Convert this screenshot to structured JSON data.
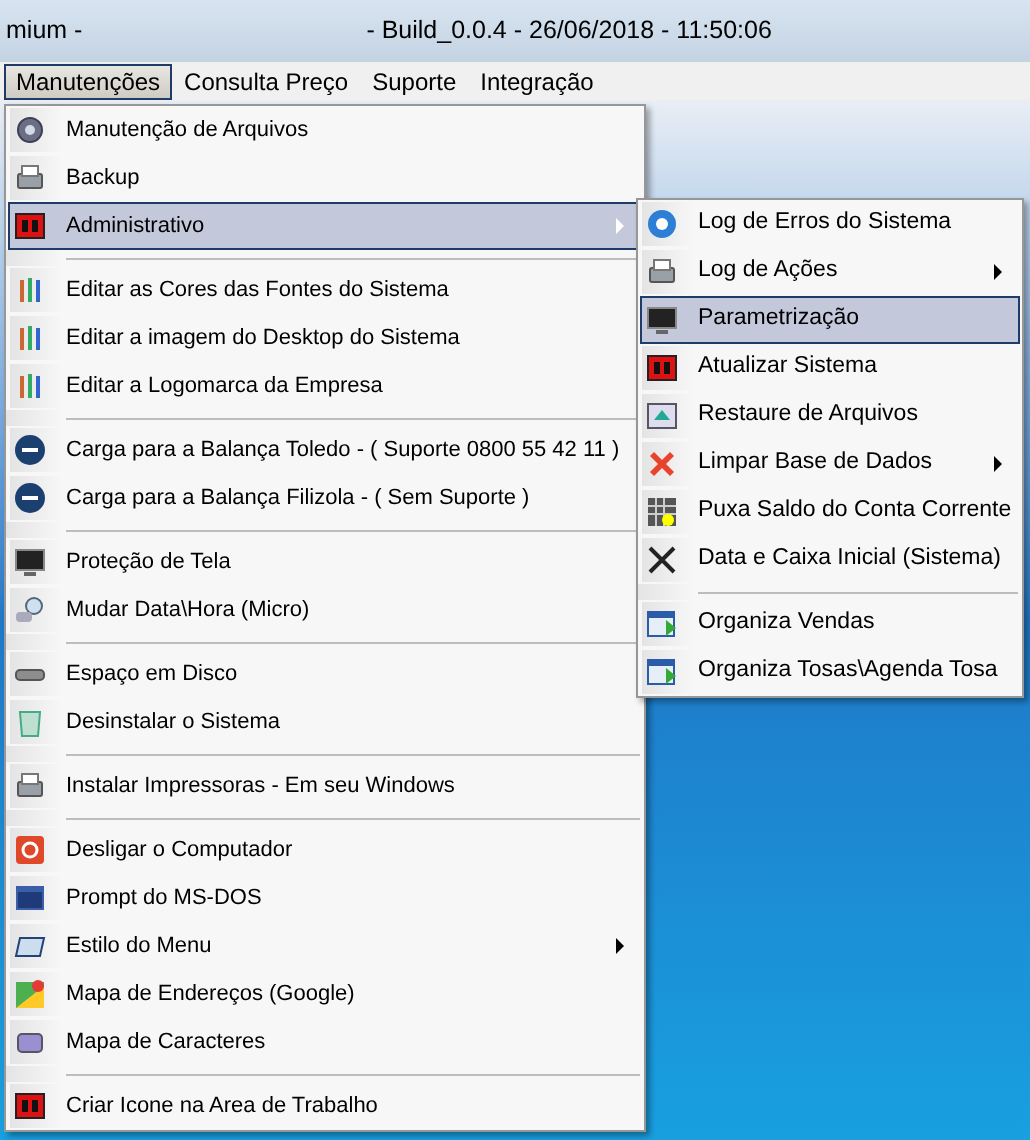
{
  "window": {
    "title_left": "mium -",
    "title": "- Build_0.0.4 - 26/06/2018 - 11:50:06"
  },
  "menu_bar": [
    {
      "label": "Manutenções",
      "selected": true
    },
    {
      "label": "Consulta Preço",
      "selected": false
    },
    {
      "label": "Suporte",
      "selected": false
    },
    {
      "label": "Integração",
      "selected": false
    }
  ],
  "menu": [
    {
      "kind": "item",
      "label": "Manutenção de Arquivos",
      "selected": false,
      "has_submenu": false
    },
    {
      "kind": "item",
      "label": "Backup",
      "selected": false,
      "has_submenu": false
    },
    {
      "kind": "item",
      "label": "Administrativo",
      "selected": true,
      "has_submenu": true
    },
    {
      "kind": "separator"
    },
    {
      "kind": "item",
      "label": "Editar as Cores das Fontes do Sistema",
      "selected": false,
      "has_submenu": false
    },
    {
      "kind": "item",
      "label": "Editar a imagem do Desktop do Sistema",
      "selected": false,
      "has_submenu": false
    },
    {
      "kind": "item",
      "label": "Editar a Logomarca da Empresa",
      "selected": false,
      "has_submenu": false
    },
    {
      "kind": "separator"
    },
    {
      "kind": "item",
      "label": "Carga para a Balança Toledo - ( Suporte 0800 55 42 11 )",
      "selected": false,
      "has_submenu": false
    },
    {
      "kind": "item",
      "label": "Carga para a Balança Filizola - ( Sem Suporte )",
      "selected": false,
      "has_submenu": false
    },
    {
      "kind": "separator"
    },
    {
      "kind": "item",
      "label": "Proteção de Tela",
      "selected": false,
      "has_submenu": false
    },
    {
      "kind": "item",
      "label": "Mudar Data\\Hora (Micro)",
      "selected": false,
      "has_submenu": false
    },
    {
      "kind": "separator"
    },
    {
      "kind": "item",
      "label": "Espaço em Disco",
      "selected": false,
      "has_submenu": false
    },
    {
      "kind": "item",
      "label": "Desinstalar o Sistema",
      "selected": false,
      "has_submenu": false
    },
    {
      "kind": "separator"
    },
    {
      "kind": "item",
      "label": "Instalar Impressoras - Em seu Windows",
      "selected": false,
      "has_submenu": false
    },
    {
      "kind": "separator"
    },
    {
      "kind": "item",
      "label": "Desligar o Computador",
      "selected": false,
      "has_submenu": false
    },
    {
      "kind": "item",
      "label": "Prompt do MS-DOS",
      "selected": false,
      "has_submenu": false
    },
    {
      "kind": "item",
      "label": "Estilo do Menu",
      "selected": false,
      "has_submenu": true
    },
    {
      "kind": "item",
      "label": "Mapa de Endereços (Google)",
      "selected": false,
      "has_submenu": false
    },
    {
      "kind": "item",
      "label": "Mapa de Caracteres",
      "selected": false,
      "has_submenu": false
    },
    {
      "kind": "separator"
    },
    {
      "kind": "item",
      "label": "Criar Icone na Area de Trabalho",
      "selected": false,
      "has_submenu": false
    }
  ],
  "submenu": [
    {
      "kind": "item",
      "label": "Log de Erros do Sistema",
      "selected": false,
      "has_submenu": false
    },
    {
      "kind": "item",
      "label": "Log de Ações",
      "selected": false,
      "has_submenu": true
    },
    {
      "kind": "item",
      "label": "Parametrização",
      "selected": true,
      "has_submenu": false
    },
    {
      "kind": "item",
      "label": "Atualizar Sistema",
      "selected": false,
      "has_submenu": false
    },
    {
      "kind": "item",
      "label": "Restaure de Arquivos",
      "selected": false,
      "has_submenu": false
    },
    {
      "kind": "item",
      "label": "Limpar Base de Dados",
      "selected": false,
      "has_submenu": true
    },
    {
      "kind": "item",
      "label": "Puxa Saldo do Conta Corrente",
      "selected": false,
      "has_submenu": false
    },
    {
      "kind": "item",
      "label": "Data e Caixa Inicial (Sistema)",
      "selected": false,
      "has_submenu": false
    },
    {
      "kind": "separator"
    },
    {
      "kind": "item",
      "label": "Organiza Vendas",
      "selected": false,
      "has_submenu": false
    },
    {
      "kind": "item",
      "label": "Organiza Tosas\\Agenda Tosa",
      "selected": false,
      "has_submenu": false
    }
  ]
}
